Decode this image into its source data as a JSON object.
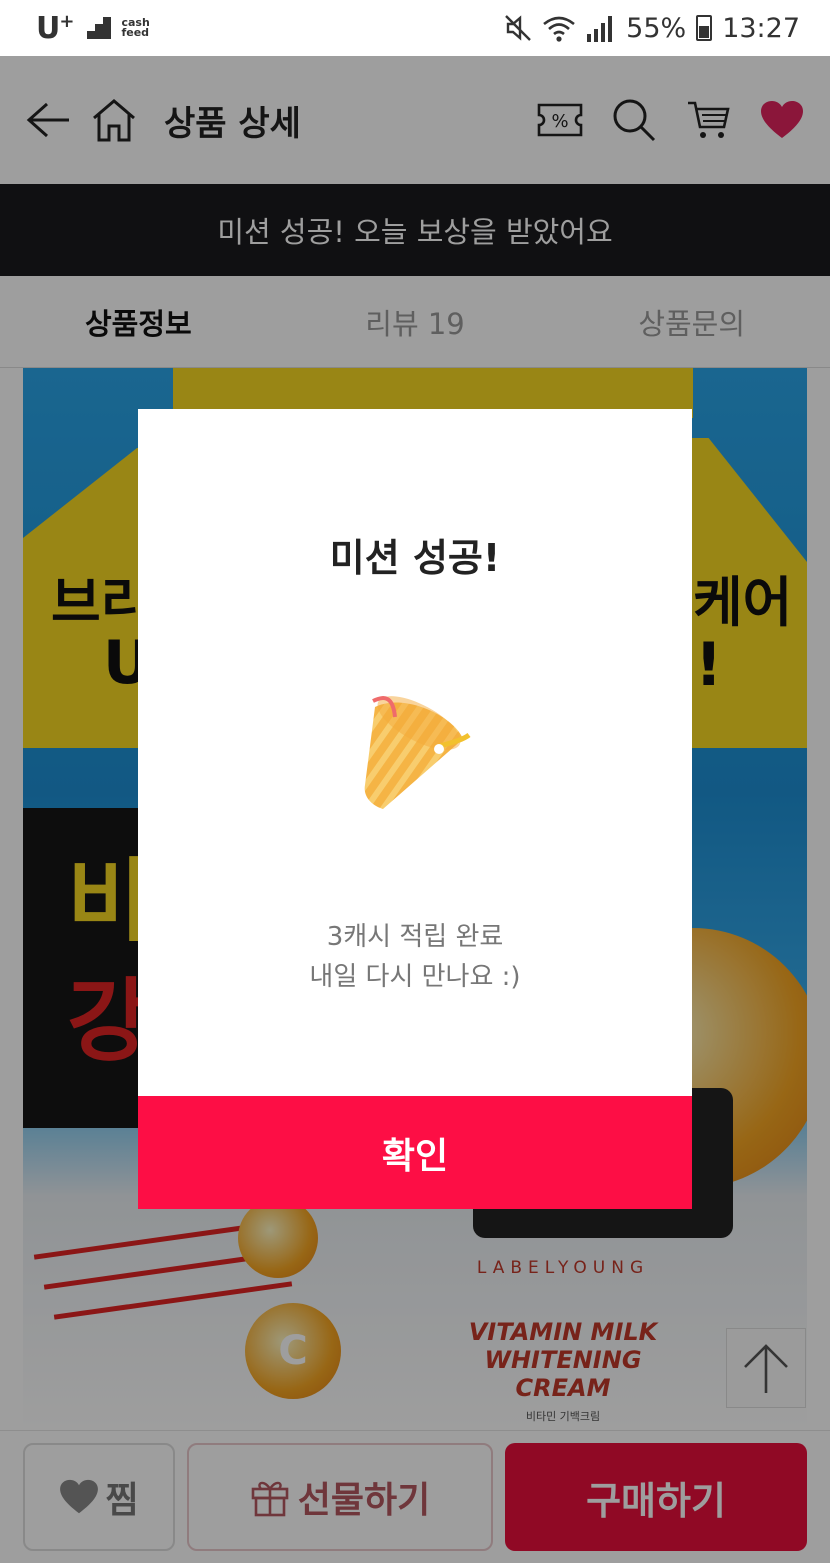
{
  "status_bar": {
    "carrier": "U",
    "carrier_sup": "+",
    "cashfeed_line1": "cash",
    "cashfeed_line2": "feed",
    "battery": "55%",
    "time": "13:27"
  },
  "header": {
    "title": "상품 상세",
    "coupon_symbol": "%",
    "wishlist_color": "#e0245e"
  },
  "banner": {
    "text": "미션 성공! 오늘 보상을 받았어요"
  },
  "tabs": [
    {
      "label": "상품정보",
      "active": true
    },
    {
      "label": "리뷰 19",
      "active": false
    },
    {
      "label": "상품문의",
      "active": false
    }
  ],
  "product_image": {
    "text_fragments": [
      "브리",
      "U",
      "케어",
      "!",
      "비",
      "강"
    ],
    "brand": "LABELYOUNG",
    "name_line1": "VITAMIN MILK",
    "name_line2": "WHITENING CREAM",
    "sub": "비타민 기백크림",
    "vitamin_label": "C"
  },
  "bottom_bar": {
    "wish_label": "찜",
    "gift_label": "선물하기",
    "buy_label": "구매하기"
  },
  "modal": {
    "title": "미션 성공!",
    "message_line1": "3캐시 적립 완료",
    "message_line2": "내일 다시 만나요 :)",
    "confirm_label": "확인",
    "accent_color": "#fd0e45"
  }
}
